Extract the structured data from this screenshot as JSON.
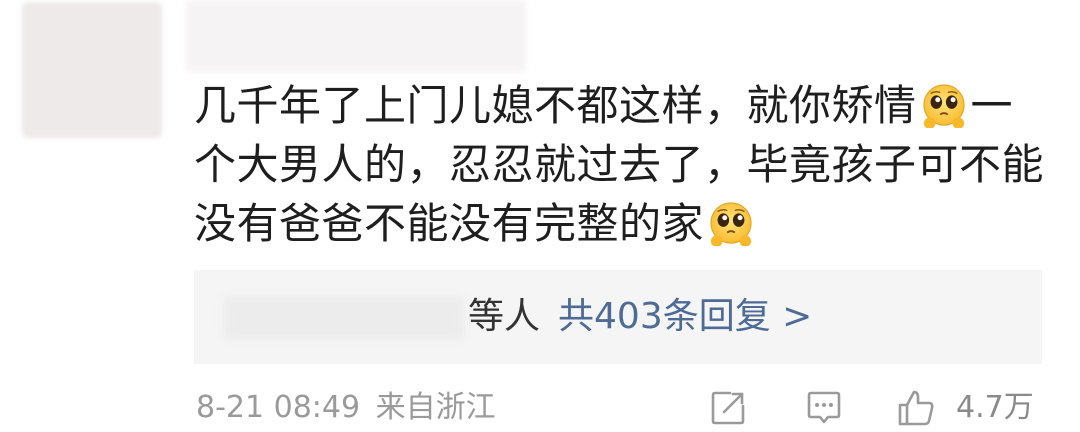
{
  "comment": {
    "lines": [
      "几千年了上门儿媳不都这样，就你矫情",
      "一",
      "个大男人的，忍忍就过去了，毕竟孩子可不能",
      "没有爸爸不能没有完整的家"
    ],
    "emojis": [
      "pleading-face-icon",
      "pleading-face-icon"
    ]
  },
  "replies": {
    "who_suffix": "等人",
    "link_text": "共403条回复 >"
  },
  "footer": {
    "date": "8-21 08:49",
    "location": "来自浙江",
    "like_count": "4.7万",
    "icons": [
      "share-icon",
      "comment-icon",
      "like-icon"
    ]
  },
  "colors": {
    "link": "#4d6b94",
    "meta": "#9a9a9a",
    "reply_bg": "#f5f5f5"
  }
}
